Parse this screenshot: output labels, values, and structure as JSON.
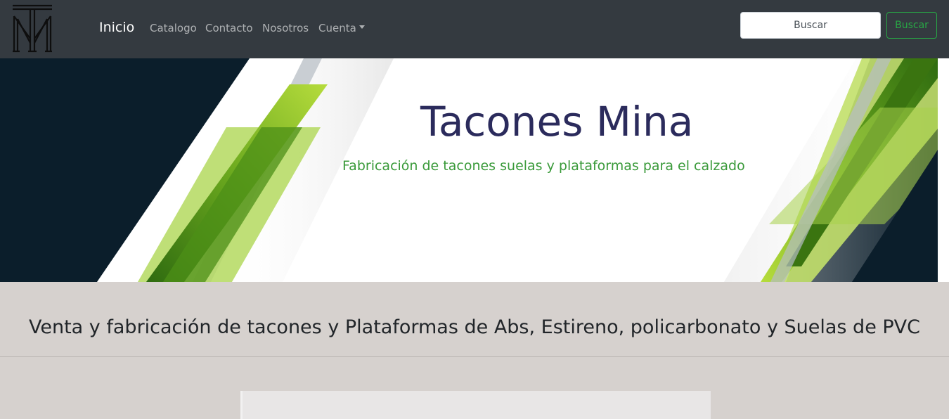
{
  "navbar": {
    "brand": "Inicio",
    "links": [
      {
        "label": "Catalogo"
      },
      {
        "label": "Contacto"
      },
      {
        "label": "Nosotros"
      },
      {
        "label": "Cuenta"
      }
    ],
    "search": {
      "placeholder": "Buscar",
      "value": "",
      "button_label": "Buscar"
    },
    "colors": {
      "background": "#343a40",
      "search_button": "#28a745"
    }
  },
  "banner": {
    "title": "Tacones Mina",
    "subtitle": "Fabricación de tacones suelas y plataformas para el calzado",
    "colors": {
      "background": "#0b1e2b",
      "green_light": "#a6d23a",
      "green_dark": "#3f7a12",
      "title": "#2b2b5c"
    }
  },
  "main": {
    "headline": "Venta y fabricación de tacones y Plataformas de Abs, Estireno, policarbonato y Suelas de PVC"
  },
  "icons": {
    "logo": "tm-monogram-logo",
    "dropdown": "caret-down-icon"
  }
}
